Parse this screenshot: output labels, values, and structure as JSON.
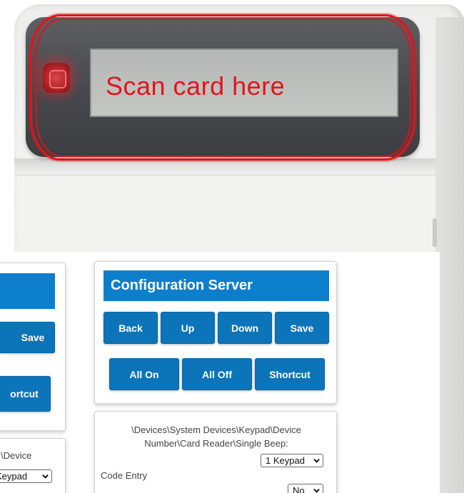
{
  "device": {
    "lcd_text": "Scan card here",
    "colors": {
      "led": "#d94a4f",
      "highlight": "#e1141b",
      "lcd_text": "#e3141c"
    }
  },
  "config_server": {
    "title": "Configuration Server",
    "buttons_row1": [
      "Back",
      "Up",
      "Down",
      "Save"
    ],
    "buttons_row2": [
      "All On",
      "All Off",
      "Shortcut"
    ],
    "path_label": "\\Devices\\System Devices\\Keypad\\Device Number\\Card Reader\\Single Beep:",
    "single_beep_value": "1 Keypad",
    "code_entry_label": "Code Entry",
    "code_entry_value": "No",
    "colors": {
      "title_bar": "#0d7ecc",
      "button": "#0c74b8"
    }
  },
  "left_partial": {
    "save_label": "Save",
    "shortcut_label": "ortcut",
    "path_fragment": "\\Device",
    "select_fragment": "Keypad"
  }
}
